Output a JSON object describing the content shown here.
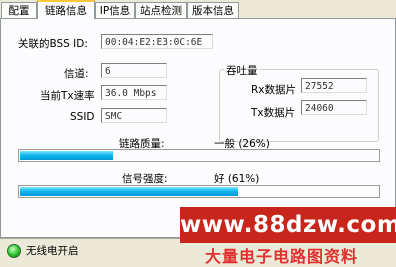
{
  "tabs": [
    "配置",
    "链路信息",
    "IP信息",
    "站点检测",
    "版本信息"
  ],
  "bssid": {
    "label": "关联的BSS ID:",
    "value": "00:04:E2:E3:0C:6E"
  },
  "channel": {
    "label": "信道:",
    "value": "6"
  },
  "tx_rate": {
    "label": "当前Tx速率",
    "value": "36.0 Mbps"
  },
  "ssid": {
    "label": "SSID",
    "value": "SMC"
  },
  "throughput": {
    "title": "吞吐量",
    "rx_label": "Rx数据片",
    "rx_value": "27552",
    "tx_label": "Tx数据片",
    "tx_value": "24060"
  },
  "link_quality": {
    "label": "链路质量:",
    "text": "一般 (26%)",
    "percent": 26
  },
  "signal_strength": {
    "label": "信号强度:",
    "text": "好 (61%)",
    "percent": 61
  },
  "status": {
    "text": "无线电开启"
  },
  "watermark": {
    "url": "www.88dzw.com",
    "caption": "大量电子电路图资料"
  },
  "colors": {
    "progress": "#0a9ee0",
    "active_tab_accent": "#ffc83c",
    "watermark_bg": "#c8251c"
  }
}
